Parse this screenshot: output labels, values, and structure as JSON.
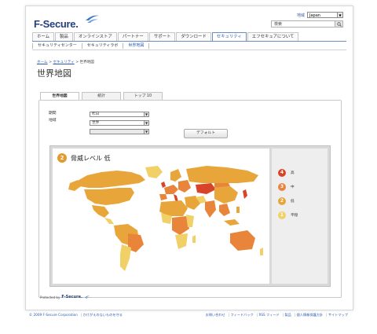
{
  "header": {
    "logo_text": "F-Secure.",
    "region_label": "地域",
    "region_value": "Japan",
    "search_placeholder": "検索"
  },
  "nav": {
    "items": [
      "ホーム",
      "製品",
      "オンラインストア",
      "パートナー",
      "サポート",
      "ダウンロード",
      "セキュリティ",
      "エフセキュアについて"
    ],
    "active_index": 6
  },
  "subnav": {
    "items": [
      "セキュリティセンター",
      "セキュリティラボ",
      "世界地図"
    ],
    "active_index": 2
  },
  "breadcrumb": {
    "home": "ホーム",
    "sep1": " > ",
    "security": "セキュリティ",
    "sep2": " > ",
    "current": "世界地図"
  },
  "page_title": "世界地図",
  "tabs": [
    "世界地図",
    "統計",
    "トップ 10"
  ],
  "active_tab": 0,
  "form": {
    "period_label": "期間",
    "period_value": "昨日",
    "region_label": "地域",
    "region_value": "世界",
    "default_button": "デフォルト"
  },
  "map": {
    "threat_level_number": "2",
    "threat_level_label": "脅威レベル 低",
    "legend": [
      {
        "num": "4",
        "label": "高",
        "color": "#d8442a"
      },
      {
        "num": "3",
        "label": "中",
        "color": "#e8853a"
      },
      {
        "num": "2",
        "label": "低",
        "color": "#e8a63a"
      },
      {
        "num": "1",
        "label": "平穏",
        "color": "#f2d068"
      }
    ]
  },
  "protected_by": {
    "text": "Protected by",
    "brand": "F-Secure."
  },
  "footer": {
    "left": [
      "© 2009 F-Secure Corporation",
      "かけがえのないものを守る"
    ],
    "right": [
      "お問い合わせ",
      "フィードバック",
      "RSS フィード",
      "製品",
      "個人情報保護方針",
      "サイトマップ"
    ]
  },
  "colors": {
    "level_high": "#d8442a",
    "level_medium": "#e8853a",
    "level_low": "#e8a63a",
    "level_calm": "#f2d068",
    "link": "#2a5bb0",
    "brand": "#24407a"
  }
}
